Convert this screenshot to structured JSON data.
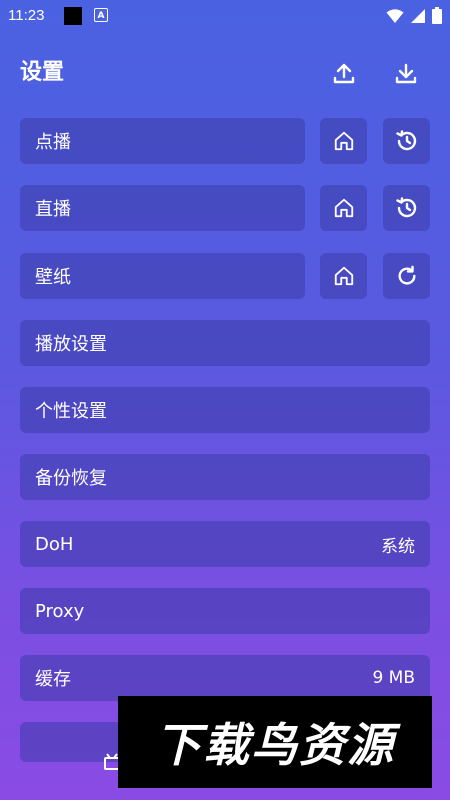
{
  "status": {
    "time": "11:23",
    "notif_letter": "A"
  },
  "header": {
    "title": "设置"
  },
  "rows": {
    "vod": {
      "label": "点播"
    },
    "live": {
      "label": "直播"
    },
    "wallpaper": {
      "label": "壁纸"
    },
    "playback": {
      "label": "播放设置"
    },
    "personal": {
      "label": "个性设置"
    },
    "backup": {
      "label": "备份恢复"
    },
    "doh": {
      "label": "DoH",
      "value": "系统"
    },
    "proxy": {
      "label": "Proxy"
    },
    "cache": {
      "label": "缓存",
      "value": "9 MB"
    }
  },
  "icons": {
    "upload": "upload-icon",
    "download": "download-icon",
    "home": "home-icon",
    "history": "history-icon",
    "refresh": "refresh-icon"
  },
  "watermark": {
    "text": "下载鸟资源"
  },
  "colors": {
    "bg_top": "#4a62e2",
    "bg_bottom": "#8a4be4",
    "row_bg": "rgba(60,60,170,0.55)"
  }
}
